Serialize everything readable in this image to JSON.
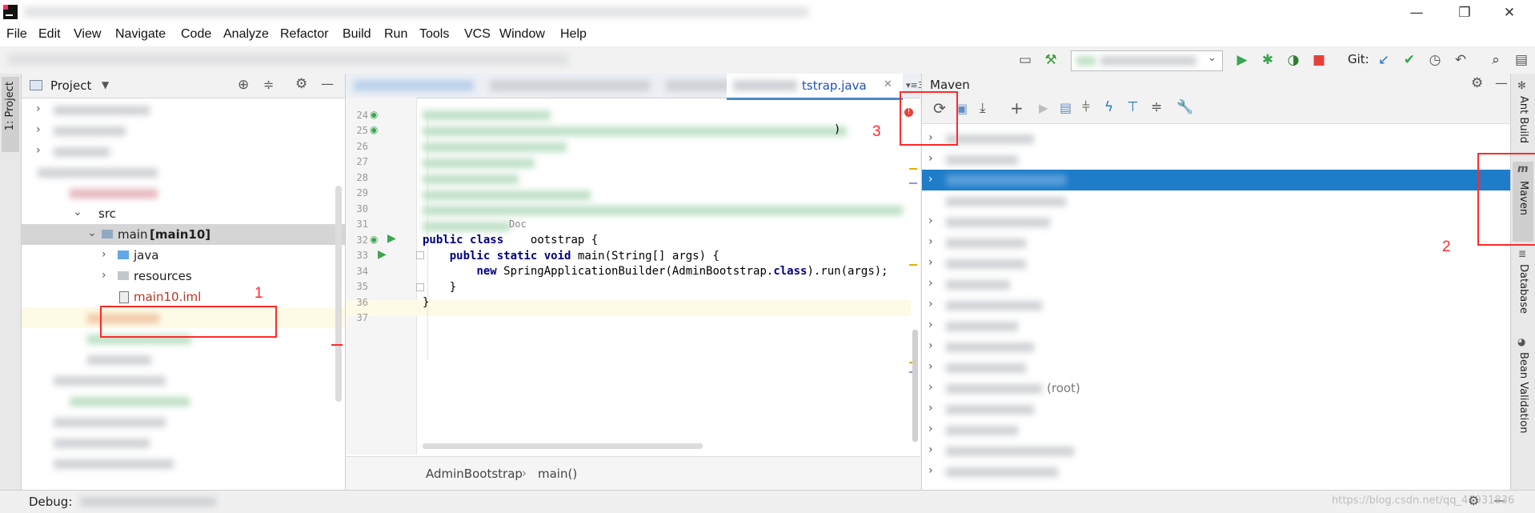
{
  "menu": [
    "File",
    "Edit",
    "View",
    "Navigate",
    "Code",
    "Analyze",
    "Refactor",
    "Build",
    "Run",
    "Tools",
    "VCS",
    "Window",
    "Help"
  ],
  "window_controls": {
    "minimize": "—",
    "restore": "❐",
    "close": "✕"
  },
  "toolbar": {
    "git_label": "Git:"
  },
  "left_stripe": {
    "project_label": "1: Project"
  },
  "project_panel": {
    "title": "Project",
    "tree": {
      "src": "src",
      "main": "main",
      "main_module": "[main10]",
      "java": "java",
      "resources": "resources",
      "iml": "main10.iml"
    }
  },
  "editor": {
    "active_tab": "tstrap.java",
    "tab_overflow": "3",
    "lines": [
      {
        "n": "24",
        "code": ""
      },
      {
        "n": "25",
        "code": ")"
      },
      {
        "n": "26",
        "code": ""
      },
      {
        "n": "27",
        "code": ""
      },
      {
        "n": "28",
        "code": ""
      },
      {
        "n": "29",
        "code": ""
      },
      {
        "n": "30",
        "code": ""
      },
      {
        "n": "31",
        "code": "Doc"
      },
      {
        "n": "32",
        "code": "public class    ootstrap {"
      },
      {
        "n": "33",
        "code": "    public static void main(String[] args) {"
      },
      {
        "n": "34",
        "code": "        new SpringApplicationBuilder(AdminBootstrap.class).run(args);"
      },
      {
        "n": "35",
        "code": "    }"
      },
      {
        "n": "36",
        "code": "}"
      },
      {
        "n": "37",
        "code": ""
      }
    ],
    "breadcrumb": {
      "class": "AdminBootstrap",
      "sep": "›",
      "method": "main()"
    }
  },
  "maven_panel": {
    "title": "Maven",
    "visible_fragment": "(root)"
  },
  "right_stripe": [
    "Ant Build",
    "Maven",
    "Database",
    "Bean Validation"
  ],
  "status_bar": {
    "left": "Debug:",
    "watermark": "https://blog.csdn.net/qq_41931836"
  },
  "annotations": {
    "box1": "1",
    "box2": "2",
    "box3": "3"
  },
  "colors": {
    "accent": "#2675bf",
    "selection": "#1f7cc8",
    "annotation": "#ff2a2a",
    "run_green": "#3aa650",
    "stop_red": "#e5413a"
  }
}
